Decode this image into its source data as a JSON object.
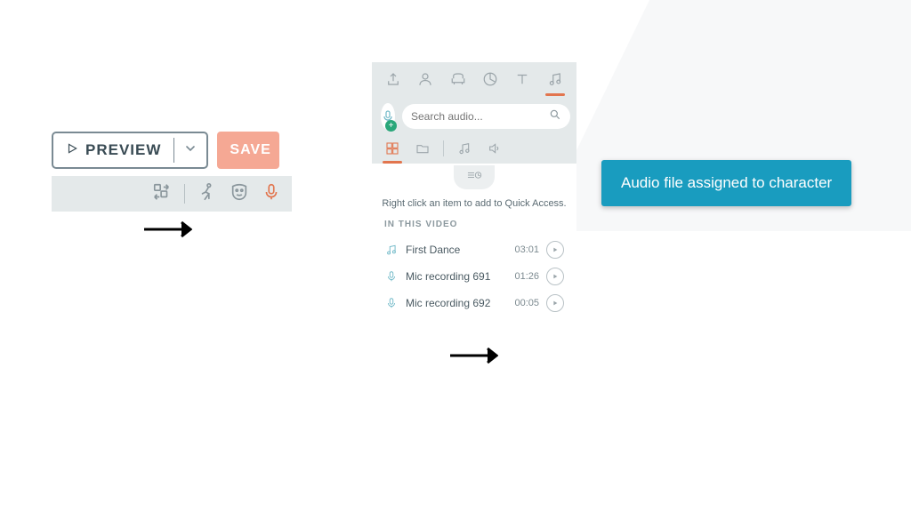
{
  "panel1": {
    "preview_label": "PREVIEW",
    "save_label": "SAVE"
  },
  "panel2": {
    "search_placeholder": "Search audio...",
    "hint": "Right click an item to add to Quick Access.",
    "section_header": "IN THIS VIDEO",
    "items": [
      {
        "name": "First Dance",
        "duration": "03:01",
        "icon": "music"
      },
      {
        "name": "Mic recording 691",
        "duration": "01:26",
        "icon": "mic"
      },
      {
        "name": "Mic recording 692",
        "duration": "00:05",
        "icon": "mic"
      }
    ]
  },
  "toast": {
    "message": "Audio file assigned to character"
  },
  "icons": {
    "plus": "+"
  }
}
